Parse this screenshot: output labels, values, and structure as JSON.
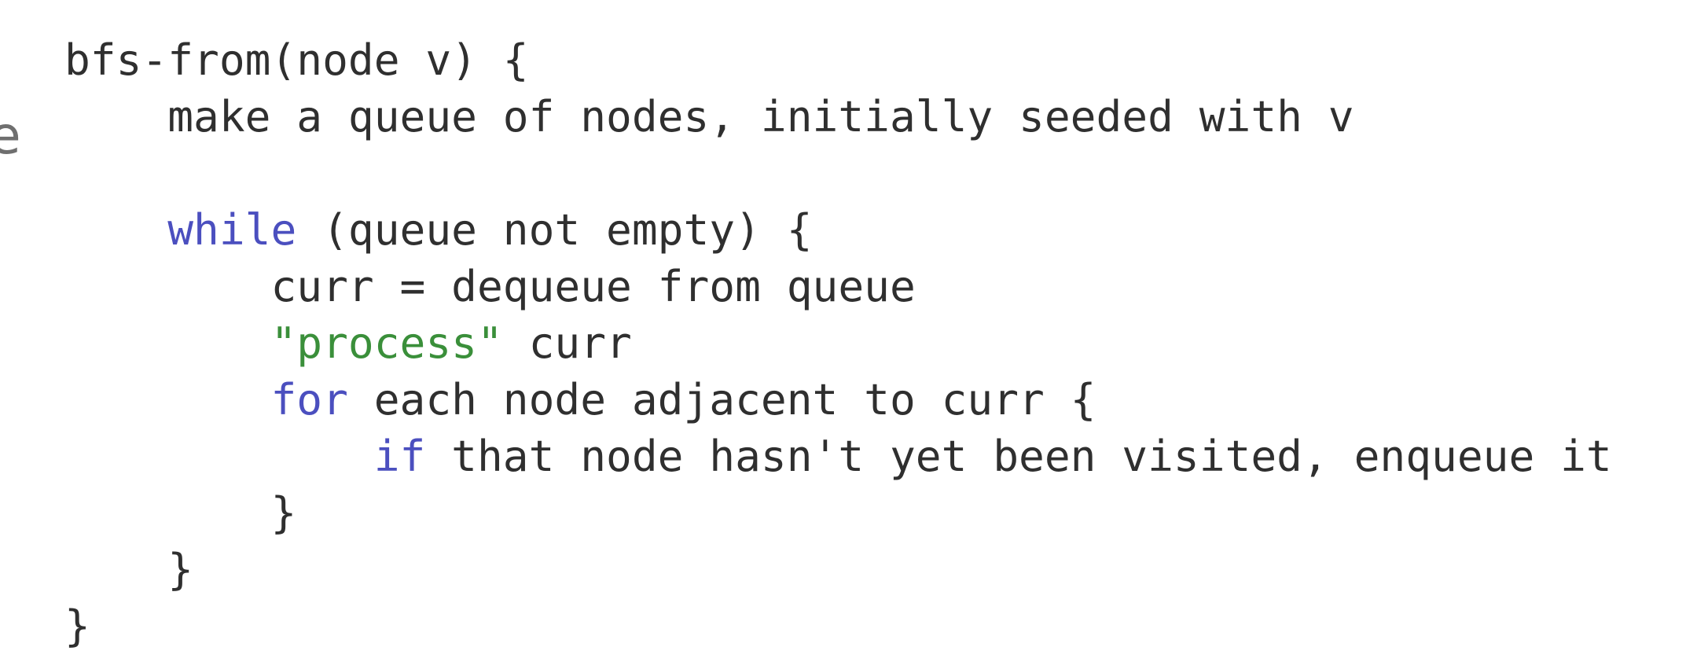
{
  "left_fragment": "e",
  "code": {
    "lines": [
      {
        "indent": "",
        "keyword": "",
        "string": "",
        "text": "bfs-from(node v) {"
      },
      {
        "indent": "    ",
        "keyword": "",
        "string": "",
        "text": "make a queue of nodes, initially seeded with v"
      },
      {
        "indent": "",
        "keyword": "",
        "string": "",
        "text": ""
      },
      {
        "indent": "    ",
        "keyword": "while",
        "string": "",
        "text": " (queue not empty) {"
      },
      {
        "indent": "        ",
        "keyword": "",
        "string": "",
        "text": "curr = dequeue from queue"
      },
      {
        "indent": "        ",
        "keyword": "",
        "string": "\"process\"",
        "text": " curr"
      },
      {
        "indent": "        ",
        "keyword": "for",
        "string": "",
        "text": " each node adjacent to curr {"
      },
      {
        "indent": "            ",
        "keyword": "if",
        "string": "",
        "text": " that node hasn't yet been visited, enqueue it"
      },
      {
        "indent": "        ",
        "keyword": "",
        "string": "",
        "text": "}"
      },
      {
        "indent": "    ",
        "keyword": "",
        "string": "",
        "text": "}"
      },
      {
        "indent": "",
        "keyword": "",
        "string": "",
        "text": "}"
      }
    ]
  },
  "colors": {
    "keyword": "#4b4fbf",
    "string": "#3a8f3a",
    "text": "#2f2f2f"
  }
}
